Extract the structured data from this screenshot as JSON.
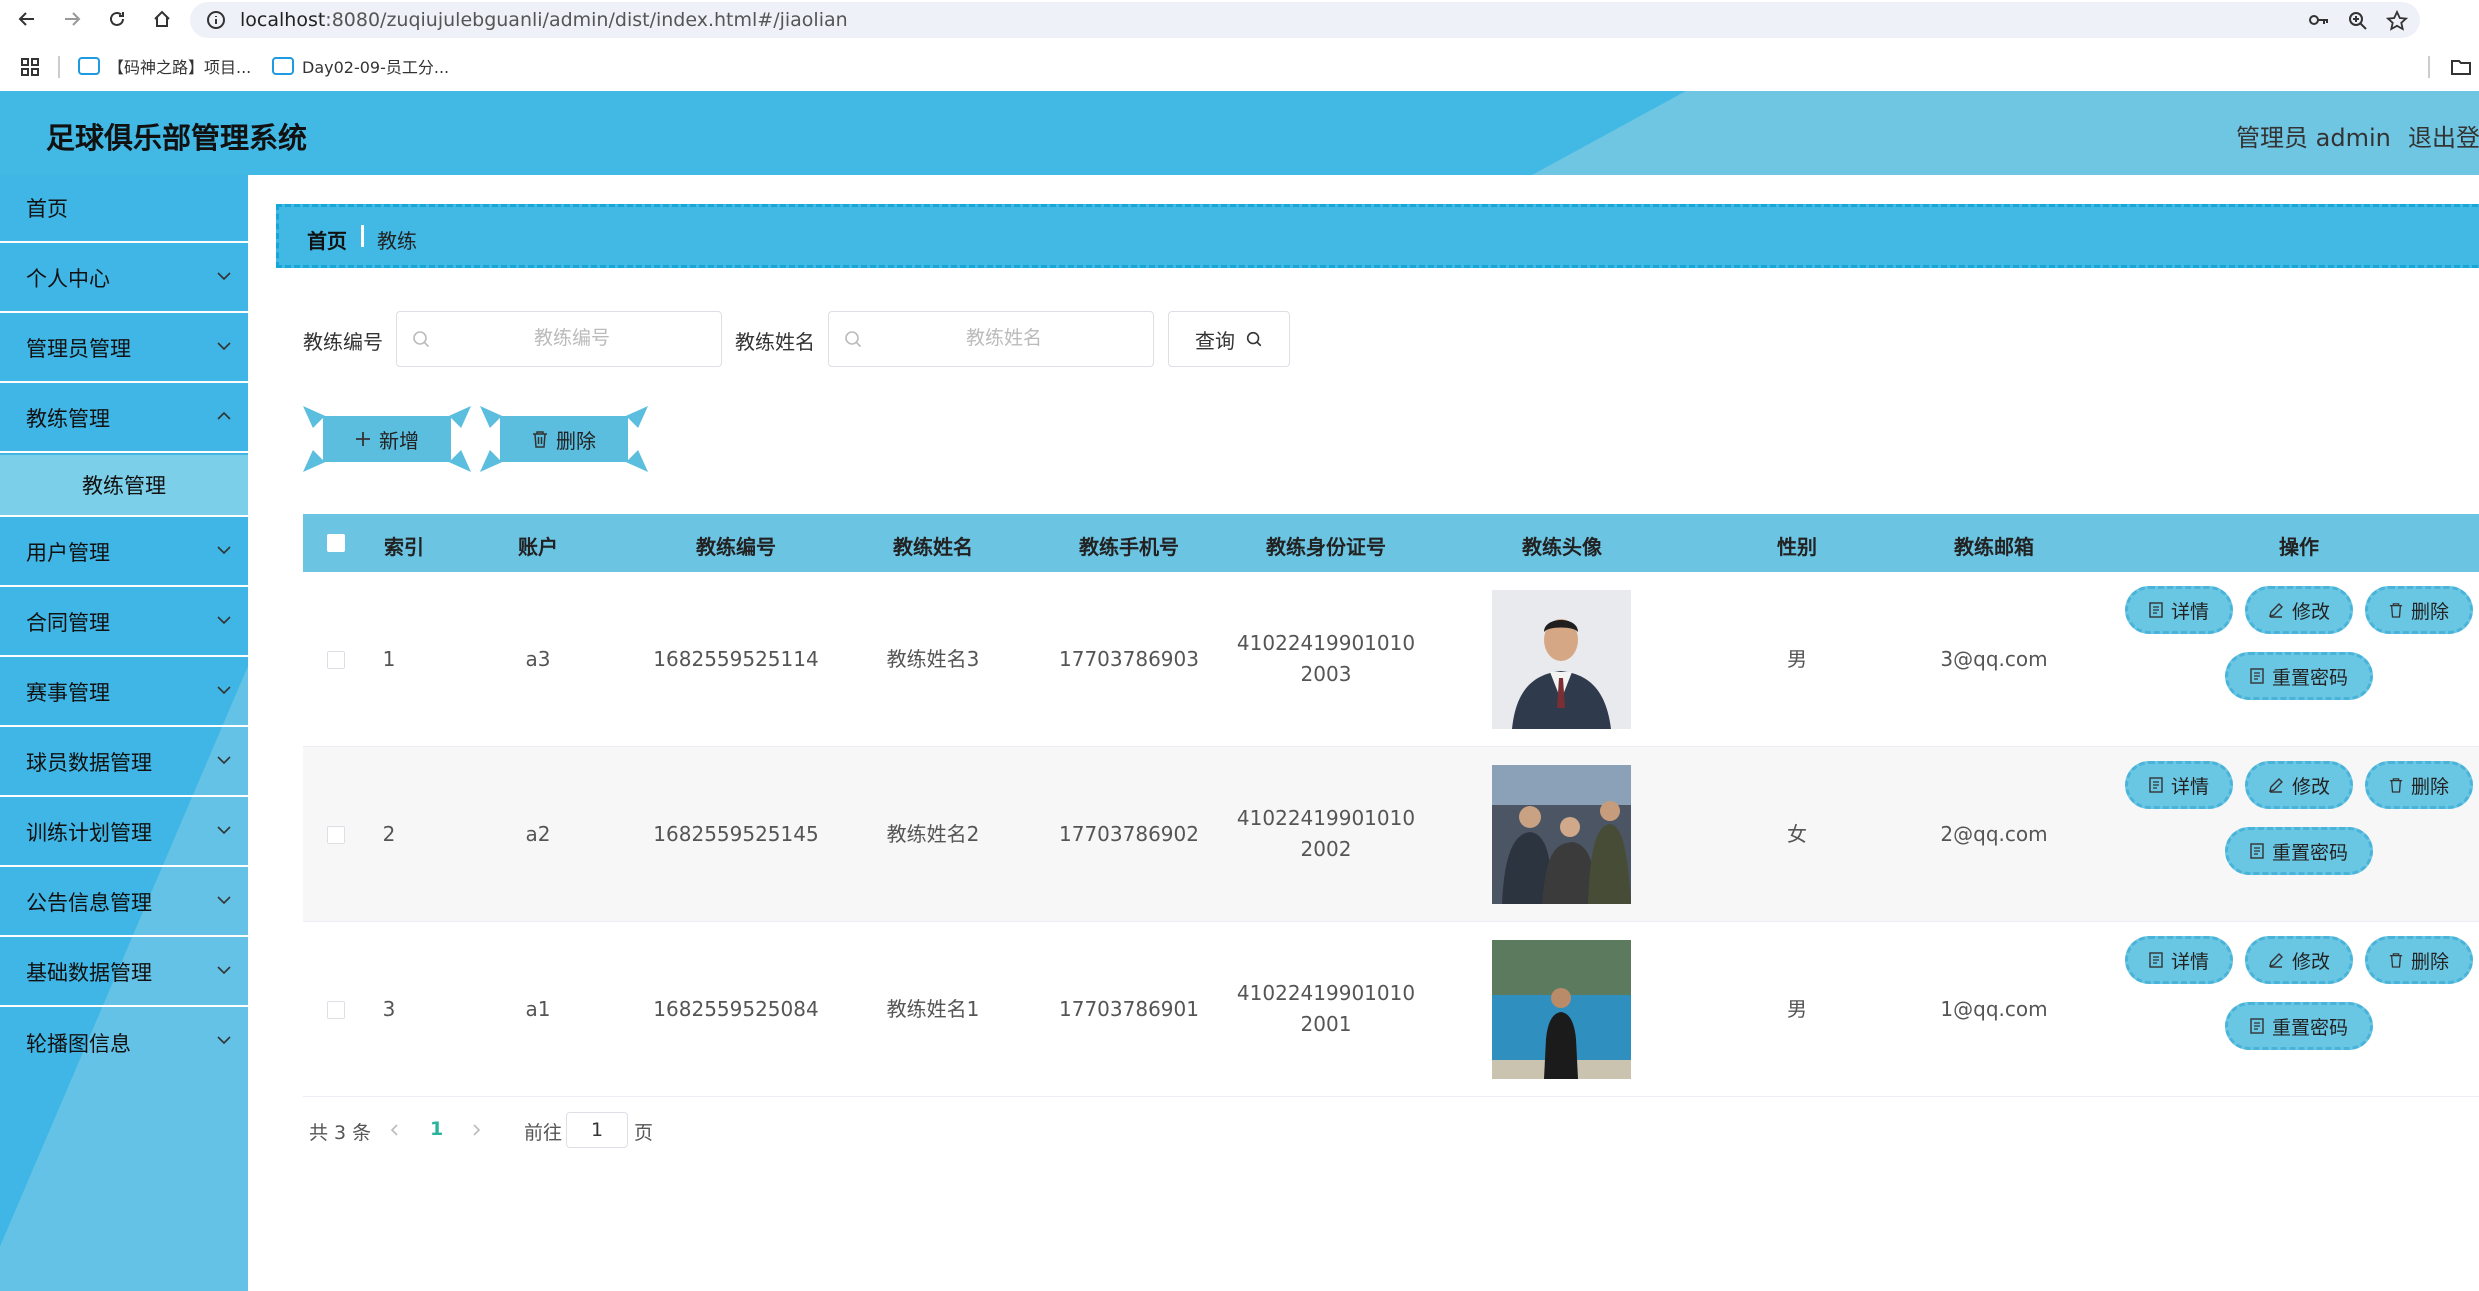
{
  "browser": {
    "url_host": "localhost",
    "url_rest": ":8080/zuqiujulebguanli/admin/dist/index.html#/jiaolian",
    "bookmarks": [
      "【码神之路】项目...",
      "Day02-09-员工分..."
    ]
  },
  "header": {
    "title": "足球俱乐部管理系统",
    "admin": "管理员 admin",
    "logout": "退出登录"
  },
  "sidebar": {
    "items": [
      {
        "label": "首页"
      },
      {
        "label": "个人中心"
      },
      {
        "label": "管理员管理"
      },
      {
        "label": "教练管理"
      },
      {
        "label": "教练管理"
      },
      {
        "label": "用户管理"
      },
      {
        "label": "合同管理"
      },
      {
        "label": "赛事管理"
      },
      {
        "label": "球员数据管理"
      },
      {
        "label": "训练计划管理"
      },
      {
        "label": "公告信息管理"
      },
      {
        "label": "基础数据管理"
      },
      {
        "label": "轮播图信息"
      }
    ]
  },
  "breadcrumb": {
    "home": "首页",
    "current": "教练"
  },
  "search": {
    "field1_label": "教练编号",
    "field1_placeholder": "教练编号",
    "field2_label": "教练姓名",
    "field2_placeholder": "教练姓名",
    "query": "查询"
  },
  "toolbar": {
    "add": "新增",
    "delete": "删除"
  },
  "table": {
    "headers": [
      "索引",
      "账户",
      "教练编号",
      "教练姓名",
      "教练手机号",
      "教练身份证号",
      "教练头像",
      "性别",
      "教练邮箱",
      "操作"
    ],
    "rows": [
      {
        "index": "1",
        "account": "a3",
        "code": "1682559525114",
        "name": "教练姓名3",
        "phone": "17703786903",
        "id_1": "41022419901010",
        "id_2": "2003",
        "gender": "男",
        "email": "3@qq.com"
      },
      {
        "index": "2",
        "account": "a2",
        "code": "1682559525145",
        "name": "教练姓名2",
        "phone": "17703786902",
        "id_1": "41022419901010",
        "id_2": "2002",
        "gender": "女",
        "email": "2@qq.com"
      },
      {
        "index": "3",
        "account": "a1",
        "code": "1682559525084",
        "name": "教练姓名1",
        "phone": "17703786901",
        "id_1": "41022419901010",
        "id_2": "2001",
        "gender": "男",
        "email": "1@qq.com"
      }
    ],
    "actions": {
      "detail": "详情",
      "edit": "修改",
      "delete": "删除",
      "reset": "重置密码"
    }
  },
  "pagination": {
    "total": "共 3 条",
    "current": "1",
    "goto": "前往",
    "page_value": "1",
    "page_suffix": "页"
  },
  "colors": {
    "header": "#42b8e4",
    "sidebar": "#3fb6e5",
    "table_head": "#6cc4e3",
    "button": "#6ac7e3",
    "active_page": "#2bb39d"
  }
}
